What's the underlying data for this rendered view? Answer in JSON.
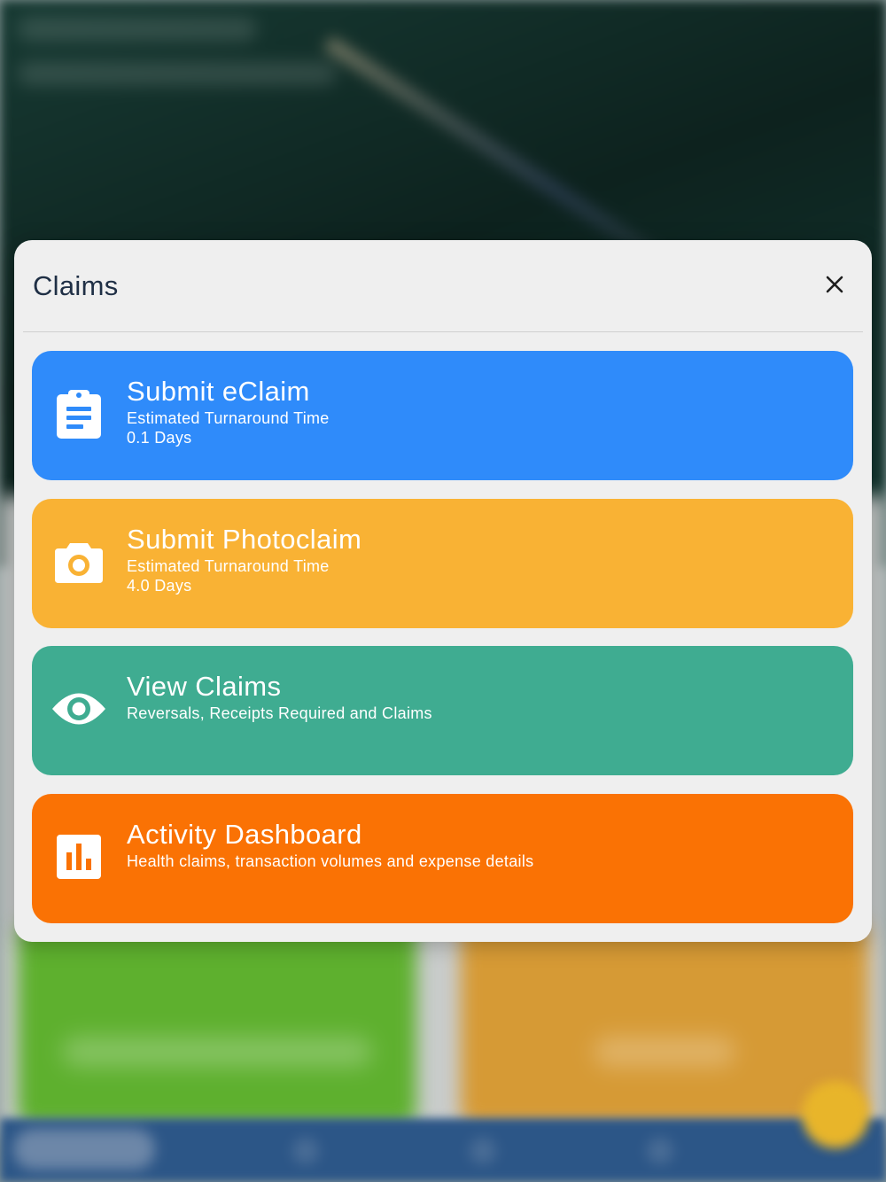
{
  "modal": {
    "title": "Claims"
  },
  "cards": [
    {
      "title": "Submit eClaim",
      "subtitle_line1": "Estimated Turnaround Time",
      "subtitle_line2": "0.1 Days",
      "icon": "clipboard-icon",
      "color": "#2f8bfa"
    },
    {
      "title": "Submit Photoclaim",
      "subtitle_line1": "Estimated Turnaround Time",
      "subtitle_line2": "4.0 Days",
      "icon": "camera-icon",
      "color": "#f9b234"
    },
    {
      "title": "View Claims",
      "subtitle_line1": "Reversals, Receipts Required and Claims",
      "icon": "eye-icon",
      "color": "#3fac91"
    },
    {
      "title": "Activity Dashboard",
      "subtitle_line1": "Health claims, transaction volumes and expense details",
      "icon": "bar-chart-icon",
      "color": "#fa7204"
    }
  ]
}
